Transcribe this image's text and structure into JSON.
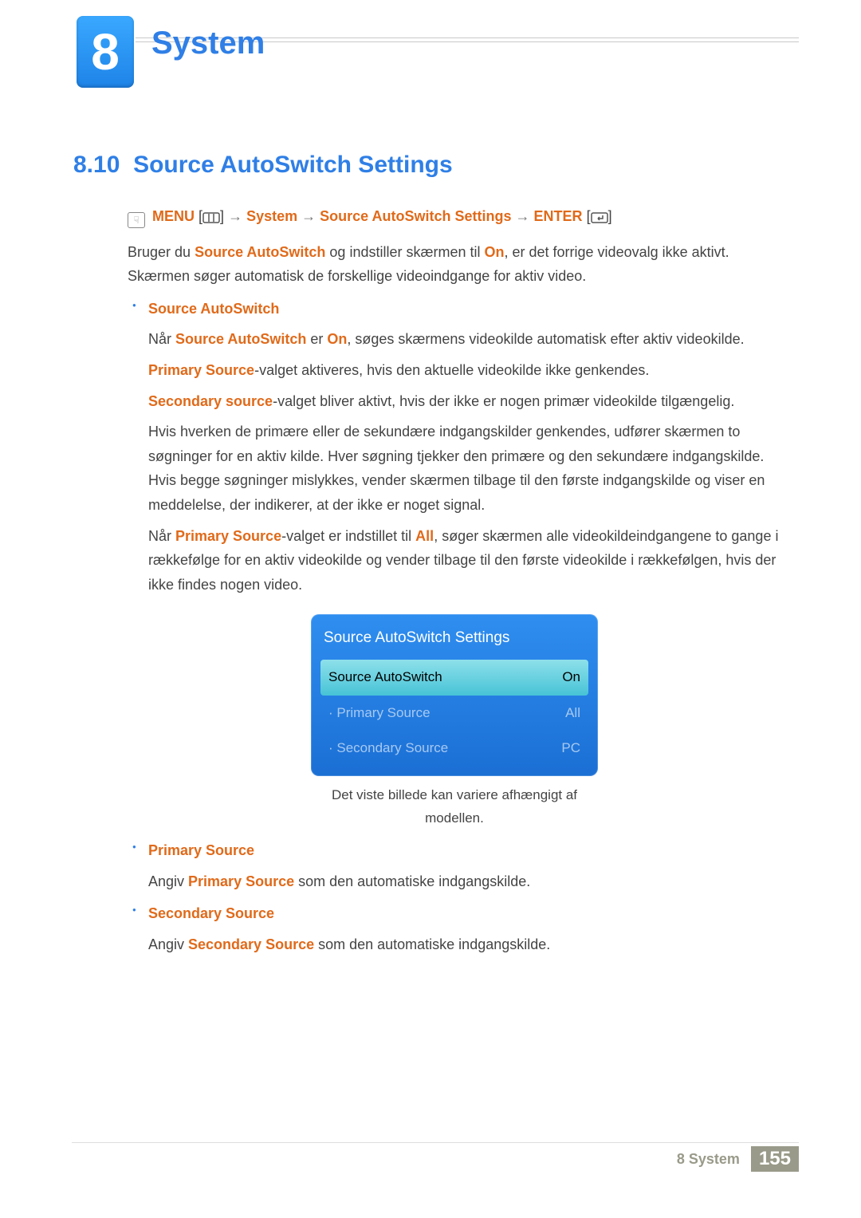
{
  "chapter": {
    "number": "8",
    "title": "System"
  },
  "section": {
    "number": "8.10",
    "title": "Source AutoSwitch Settings"
  },
  "nav": {
    "menu": "MENU",
    "arrow": "→",
    "sys": "System",
    "page": "Source AutoSwitch Settings",
    "enter": "ENTER"
  },
  "intro": {
    "p1_a": "Bruger du ",
    "p1_b": "Source AutoSwitch",
    "p1_c": " og indstiller skærmen til ",
    "p1_d": "On",
    "p1_e": ", er det forrige videovalg ikke aktivt. Skærmen søger automatisk de forskellige videoindgange for aktiv video."
  },
  "items": {
    "sa": {
      "heading": "Source AutoSwitch",
      "p1_a": "Når ",
      "p1_b": "Source AutoSwitch",
      "p1_c": " er ",
      "p1_d": "On",
      "p1_e": ", søges skærmens videokilde automatisk efter aktiv videokilde.",
      "p2_a": "Primary Source",
      "p2_b": "-valget aktiveres, hvis den aktuelle videokilde ikke genkendes.",
      "p3_a": "Secondary source",
      "p3_b": "-valget bliver aktivt, hvis der ikke er nogen primær videokilde tilgængelig.",
      "p4": "Hvis hverken de primære eller de sekundære indgangskilder genkendes, udfører skærmen to søgninger for en aktiv kilde. Hver søgning tjekker den primære og den sekundære indgangskilde. Hvis begge søgninger mislykkes, vender skærmen tilbage til den første indgangskilde og viser en meddelelse, der indikerer, at der ikke er noget signal.",
      "p5_a": "Når ",
      "p5_b": "Primary Source",
      "p5_c": "-valget er indstillet til ",
      "p5_d": "All",
      "p5_e": ", søger skærmen alle videokildeindgangene to gange i rækkefølge for en aktiv videokilde og vender tilbage til den første videokilde i rækkefølgen, hvis der ikke findes nogen video."
    },
    "ps": {
      "heading": "Primary Source",
      "p_a": "Angiv ",
      "p_b": "Primary Source",
      "p_c": " som den automatiske indgangskilde."
    },
    "ss": {
      "heading": "Secondary Source",
      "p_a": "Angiv ",
      "p_b": "Secondary Source",
      "p_c": " som den automatiske indgangskilde."
    }
  },
  "osd": {
    "title": "Source AutoSwitch Settings",
    "rows": [
      {
        "label": "Source AutoSwitch",
        "value": "On"
      },
      {
        "label": "Primary Source",
        "value": "All"
      },
      {
        "label": "Secondary Source",
        "value": "PC"
      }
    ],
    "caption": "Det viste billede kan variere afhængigt af modellen."
  },
  "footer": {
    "label": "8 System",
    "pageno": "155"
  }
}
